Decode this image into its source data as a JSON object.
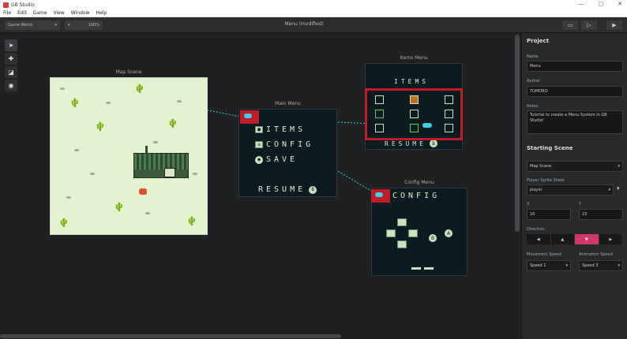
{
  "window": {
    "title": "GB Studio",
    "min": "—",
    "max": "▢",
    "close": "✕"
  },
  "menu": [
    "File",
    "Edit",
    "Game",
    "View",
    "Window",
    "Help"
  ],
  "toolbar": {
    "project_select": "Game World",
    "zoom_select": "100%",
    "title": "Menu (modified)",
    "folder_icon": "folder-icon",
    "window_icon": "window-icon",
    "play_icon": "play-icon"
  },
  "tools": [
    "select",
    "add",
    "eraser",
    "paint"
  ],
  "scenes": {
    "map": {
      "label": "Map Scene"
    },
    "main_menu": {
      "label": "Main Menu",
      "items": [
        "ITEMS",
        "CONFIG",
        "SAVE"
      ],
      "resume": "RESUME"
    },
    "items_menu": {
      "label": "Items Menu",
      "title": "ITEMS",
      "resume": "RESUME"
    },
    "config_menu": {
      "label": "Config Menu",
      "title": "CONFIG"
    }
  },
  "sidebar": {
    "project_heading": "Project",
    "name_label": "Name",
    "name_value": "Menu",
    "author_label": "Author",
    "author_value": "TOMORO",
    "notes_label": "Notes",
    "notes_value": "Tutorial to create a Menu System in GB Studio!",
    "starting_heading": "Starting Scene",
    "starting_scene": "Map Scene",
    "sprite_label": "Player Sprite Sheet",
    "sprite_value": "player",
    "x_label": "X",
    "x_value": "16",
    "y_label": "Y",
    "y_value": "23",
    "direction_label": "Direction",
    "directions": [
      "◀",
      "▲",
      "▼",
      "▶"
    ],
    "movement_label": "Movement Speed",
    "movement_value": "Speed 1",
    "animation_label": "Animation Speed",
    "animation_value": "Speed 3"
  },
  "colors": {
    "accent": "#d0386b",
    "trigger": "#c01c28",
    "link": "#3fd0e8"
  }
}
